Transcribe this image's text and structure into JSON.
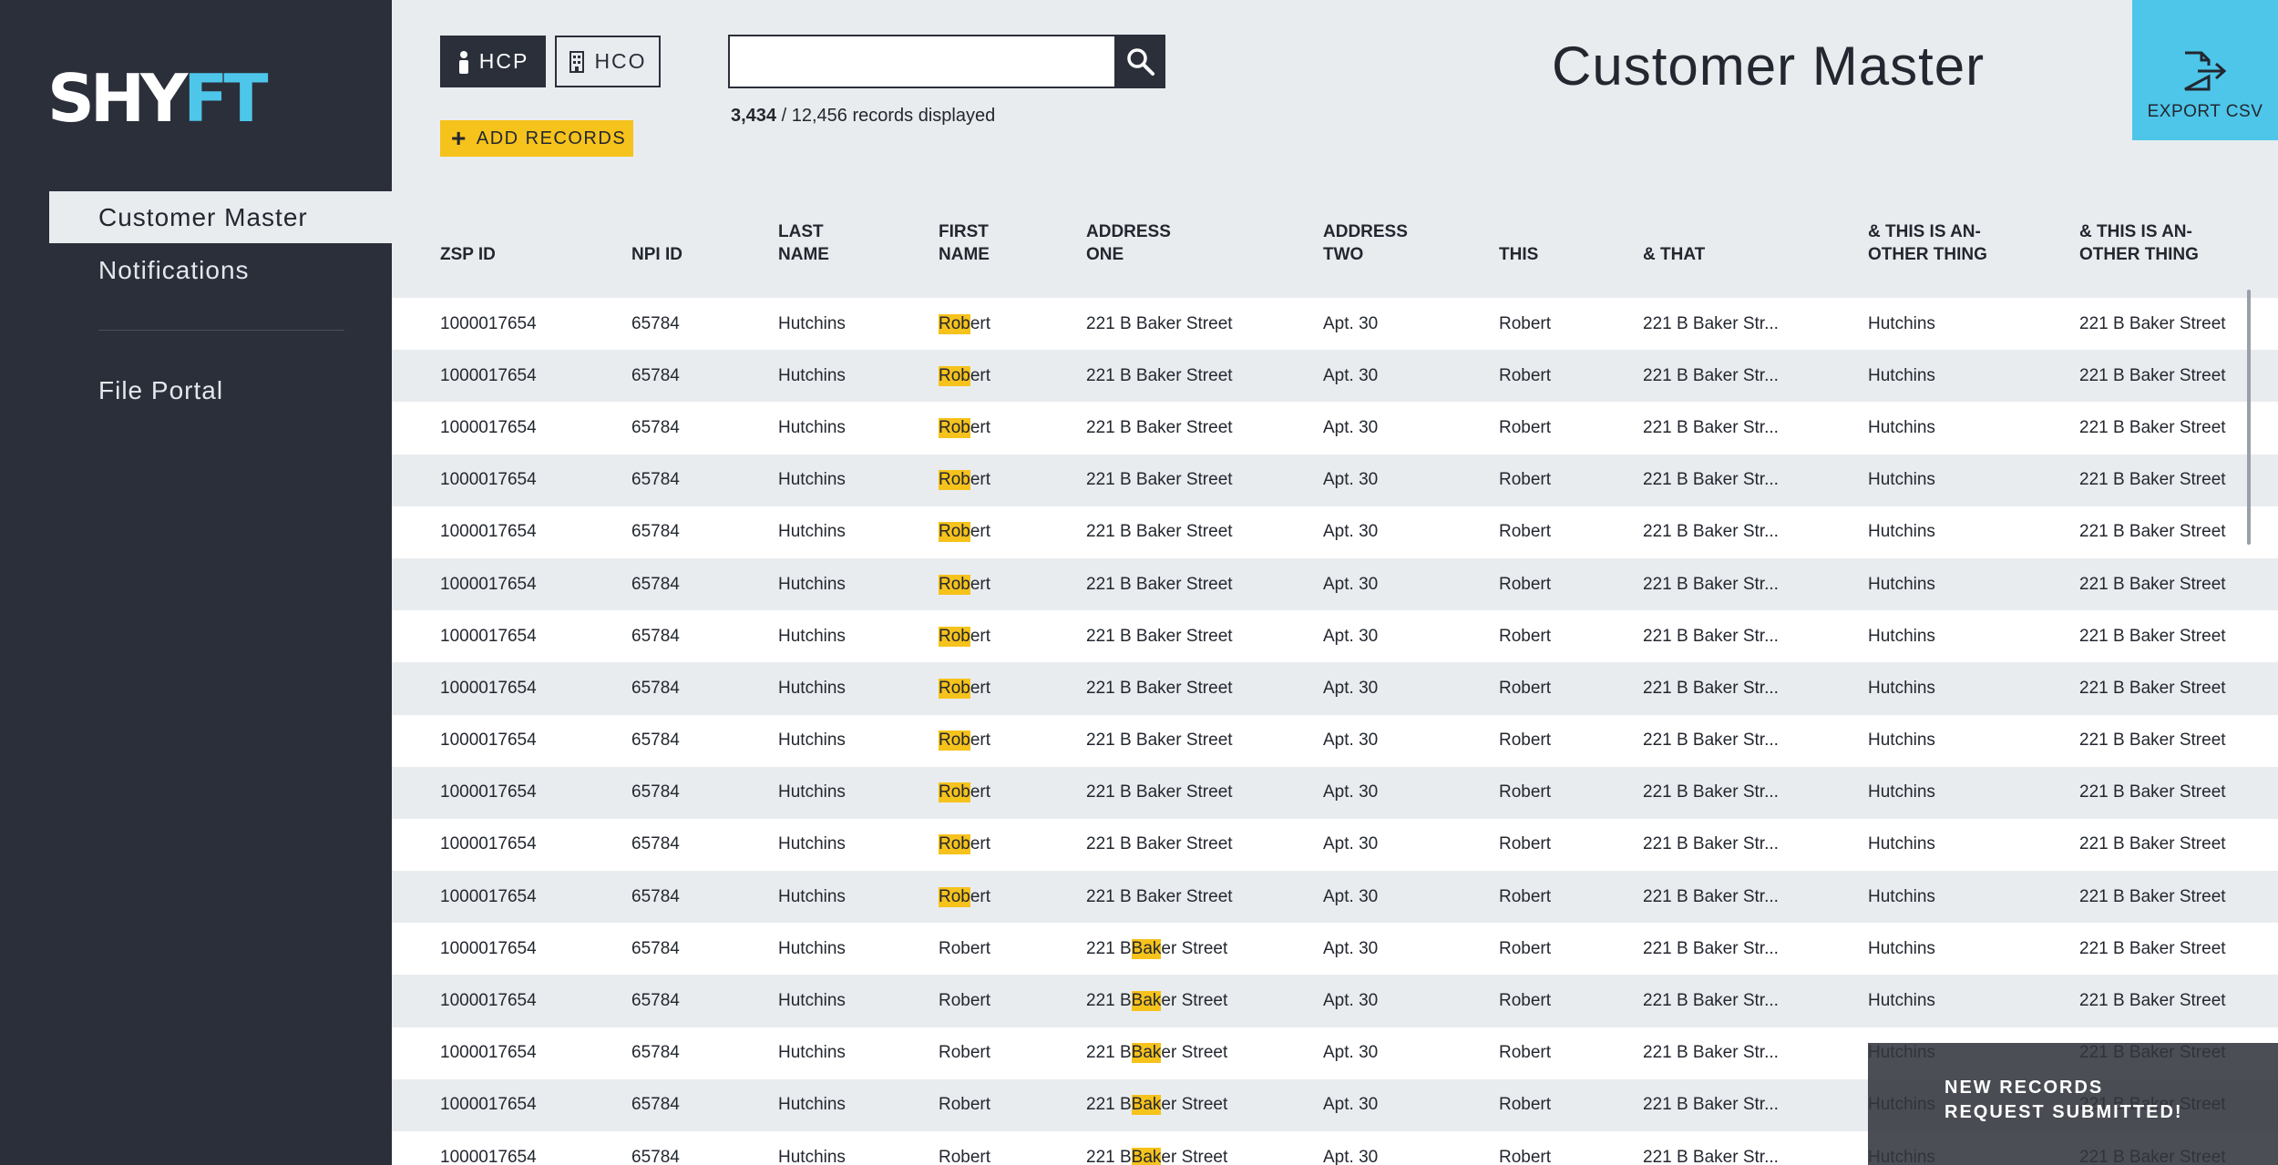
{
  "sidebar": {
    "logo": {
      "part1": "SHY",
      "part2": "FT"
    },
    "items": [
      {
        "label": "Customer Master",
        "active": true
      },
      {
        "label": "Notifications",
        "active": false
      },
      {
        "label": "File Portal",
        "active": false
      }
    ]
  },
  "toolbar": {
    "hcp_label": "HCP",
    "hco_label": "HCO",
    "add_label": "ADD RECORDS",
    "export_label": "EXPORT CSV"
  },
  "search": {
    "value": "",
    "placeholder": ""
  },
  "records": {
    "displayed": "3,434",
    "total": "/ 12,456 records displayed"
  },
  "page_title": "Customer Master",
  "table": {
    "headers": [
      {
        "line1": "",
        "line2": "ZSP ID"
      },
      {
        "line1": "",
        "line2": "NPI ID"
      },
      {
        "line1": "LAST",
        "line2": "NAME"
      },
      {
        "line1": "FIRST",
        "line2": "NAME"
      },
      {
        "line1": "ADDRESS",
        "line2": "ONE"
      },
      {
        "line1": "ADDRESS",
        "line2": "TWO"
      },
      {
        "line1": "",
        "line2": "THIS"
      },
      {
        "line1": "",
        "line2": "& THAT"
      },
      {
        "line1": "& THIS IS AN-",
        "line2": "OTHER THING"
      },
      {
        "line1": "& THIS IS AN-",
        "line2": "OTHER THING"
      }
    ],
    "rows": [
      [
        "1000017654",
        "65784",
        "Hutchins",
        "Robert",
        "221 B Baker Street",
        "Apt. 30",
        "Robert",
        "221 B Baker Str...",
        "Hutchins",
        "221 B Baker Street"
      ],
      [
        "1000017654",
        "65784",
        "Hutchins",
        "Robert",
        "221 B Baker Street",
        "Apt. 30",
        "Robert",
        "221 B Baker Str...",
        "Hutchins",
        "221 B Baker Street"
      ],
      [
        "1000017654",
        "65784",
        "Hutchins",
        "Robert",
        "221 B Baker Street",
        "Apt. 30",
        "Robert",
        "221 B Baker Str...",
        "Hutchins",
        "221 B Baker Street"
      ],
      [
        "1000017654",
        "65784",
        "Hutchins",
        "Robert",
        "221 B Baker Street",
        "Apt. 30",
        "Robert",
        "221 B Baker Str...",
        "Hutchins",
        "221 B Baker Street"
      ],
      [
        "1000017654",
        "65784",
        "Hutchins",
        "Robert",
        "221 B Baker Street",
        "Apt. 30",
        "Robert",
        "221 B Baker Str...",
        "Hutchins",
        "221 B Baker Street"
      ],
      [
        "1000017654",
        "65784",
        "Hutchins",
        "Robert",
        "221 B Baker Street",
        "Apt. 30",
        "Robert",
        "221 B Baker Str...",
        "Hutchins",
        "221 B Baker Street"
      ],
      [
        "1000017654",
        "65784",
        "Hutchins",
        "Robert",
        "221 B Baker Street",
        "Apt. 30",
        "Robert",
        "221 B Baker Str...",
        "Hutchins",
        "221 B Baker Street"
      ],
      [
        "1000017654",
        "65784",
        "Hutchins",
        "Robert",
        "221 B Baker Street",
        "Apt. 30",
        "Robert",
        "221 B Baker Str...",
        "Hutchins",
        "221 B Baker Street"
      ],
      [
        "1000017654",
        "65784",
        "Hutchins",
        "Robert",
        "221 B Baker Street",
        "Apt. 30",
        "Robert",
        "221 B Baker Str...",
        "Hutchins",
        "221 B Baker Street"
      ],
      [
        "1000017654",
        "65784",
        "Hutchins",
        "Robert",
        "221 B Baker Street",
        "Apt. 30",
        "Robert",
        "221 B Baker Str...",
        "Hutchins",
        "221 B Baker Street"
      ],
      [
        "1000017654",
        "65784",
        "Hutchins",
        "Robert",
        "221 B Baker Street",
        "Apt. 30",
        "Robert",
        "221 B Baker Str...",
        "Hutchins",
        "221 B Baker Street"
      ],
      [
        "1000017654",
        "65784",
        "Hutchins",
        "Robert",
        "221 B Baker Street",
        "Apt. 30",
        "Robert",
        "221 B Baker Str...",
        "Hutchins",
        "221 B Baker Street"
      ],
      [
        "1000017654",
        "65784",
        "Hutchins",
        "Robert",
        "221 B Baker Street",
        "Apt. 30",
        "Robert",
        "221 B Baker Str...",
        "Hutchins",
        "221 B Baker Street"
      ],
      [
        "1000017654",
        "65784",
        "Hutchins",
        "Robert",
        "221 B Baker Street",
        "Apt. 30",
        "Robert",
        "221 B Baker Str...",
        "Hutchins",
        "221 B Baker Street"
      ],
      [
        "1000017654",
        "65784",
        "Hutchins",
        "Robert",
        "221 B Baker Street",
        "Apt. 30",
        "Robert",
        "221 B Baker Str...",
        "Hutchins",
        "221 B Baker Street"
      ],
      [
        "1000017654",
        "65784",
        "Hutchins",
        "Robert",
        "221 B Baker Street",
        "Apt. 30",
        "Robert",
        "221 B Baker Str...",
        "Hutchins",
        "221 B Baker Street"
      ],
      [
        "1000017654",
        "65784",
        "Hutchins",
        "Robert",
        "221 B Baker Street",
        "Apt. 30",
        "Robert",
        "221 B Baker Str...",
        "Hutchins",
        "221 B Baker Street"
      ]
    ],
    "highlights": [
      {
        "rows": [
          0,
          1,
          2,
          3,
          4,
          5,
          6,
          7,
          8,
          9,
          10,
          11
        ],
        "column": 3,
        "match": "Rob"
      },
      {
        "rows": [
          12,
          13,
          14,
          15,
          16
        ],
        "column": 4,
        "match": "Bak"
      }
    ]
  },
  "toast": {
    "line1": "NEW RECORDS",
    "line2": "REQUEST SUBMITTED!"
  },
  "colors": {
    "sidebar_bg": "#2b2f3a",
    "page_bg": "#e9ecef",
    "accent_yellow": "#f6c21c",
    "accent_blue": "#4ec6ea"
  }
}
